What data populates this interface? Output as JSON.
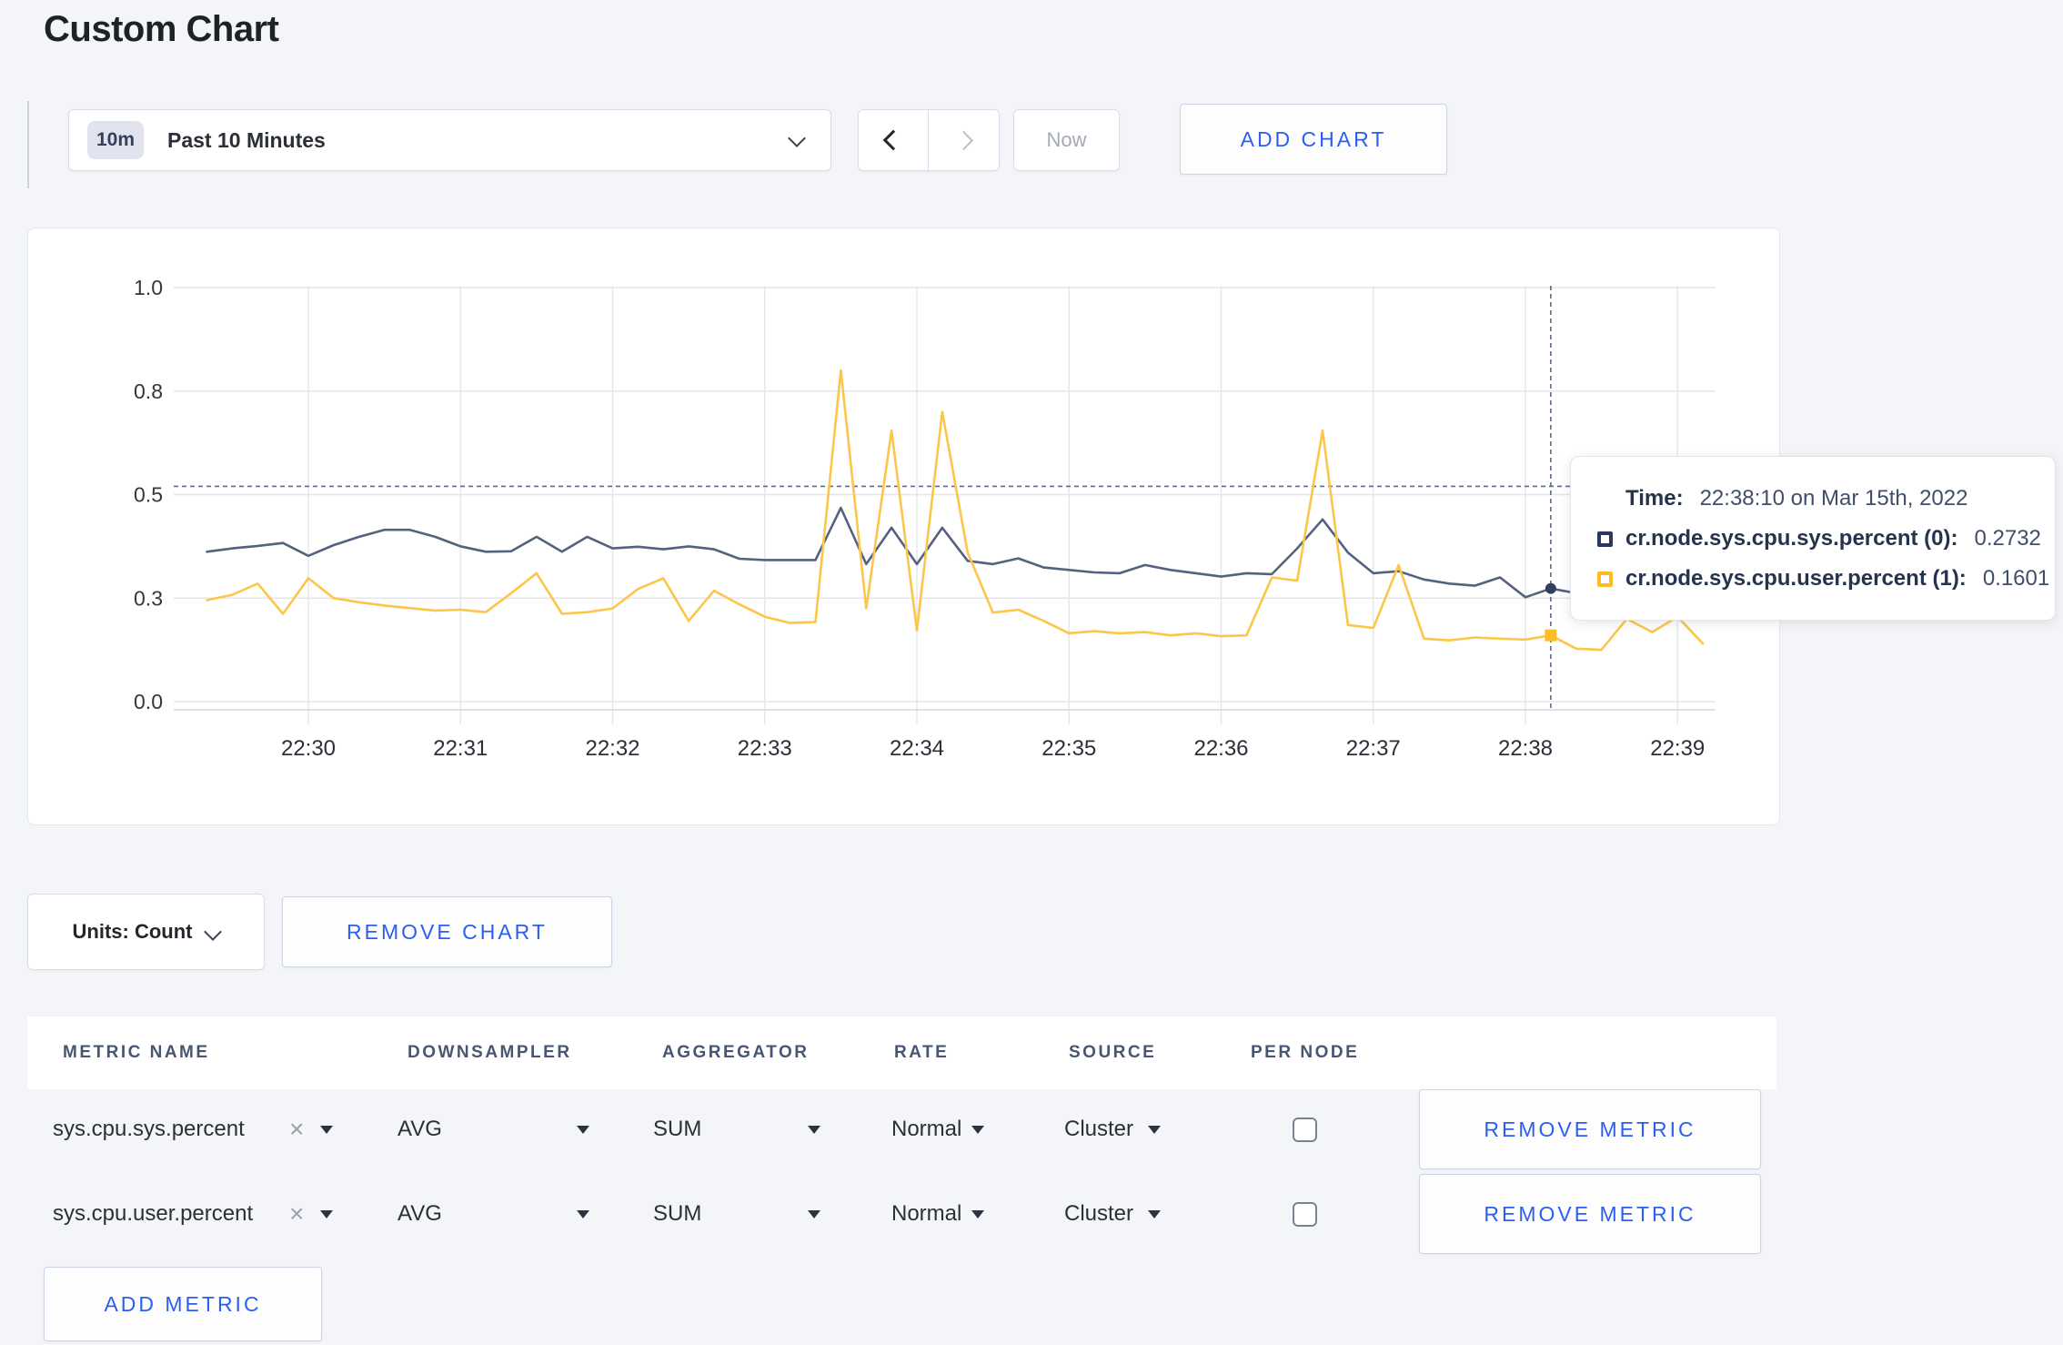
{
  "page": {
    "title": "Custom Chart",
    "background": "#f4f5f8",
    "accent_blue": "#2c5ef0"
  },
  "toolbar": {
    "time_window_badge": "10m",
    "time_window_label": "Past 10 Minutes",
    "now_label": "Now",
    "add_chart_label": "ADD CHART",
    "icons": {
      "time_dropdown": "chevron-down-icon",
      "previous": "chevron-left-icon",
      "next": "chevron-right-icon"
    }
  },
  "chart_data": {
    "type": "line",
    "title": "",
    "xlabel": "",
    "ylabel": "",
    "ylim": [
      0,
      1
    ],
    "grid": true,
    "legend_position": "none",
    "yticks": [
      {
        "v": 0,
        "label": "0.0"
      },
      {
        "v": 0.25,
        "label": "0.3"
      },
      {
        "v": 0.5,
        "label": "0.5"
      },
      {
        "v": 0.75,
        "label": "0.8"
      },
      {
        "v": 1.0,
        "label": "1.0"
      }
    ],
    "xticks": [
      {
        "s": 0,
        "label": "22:30"
      },
      {
        "s": 60,
        "label": "22:31"
      },
      {
        "s": 120,
        "label": "22:32"
      },
      {
        "s": 180,
        "label": "22:33"
      },
      {
        "s": 240,
        "label": "22:34"
      },
      {
        "s": 300,
        "label": "22:35"
      },
      {
        "s": 360,
        "label": "22:36"
      },
      {
        "s": 420,
        "label": "22:37"
      },
      {
        "s": 480,
        "label": "22:38"
      },
      {
        "s": 540,
        "label": "22:39"
      }
    ],
    "x_start_seconds": -40,
    "x_step_seconds": 10,
    "series": [
      {
        "name": "cr.node.sys.cpu.sys.percent (0)",
        "color": "#55627f",
        "values": [
          0.362,
          0.37,
          0.376,
          0.383,
          0.352,
          0.378,
          0.398,
          0.415,
          0.415,
          0.398,
          0.375,
          0.362,
          0.363,
          0.398,
          0.362,
          0.398,
          0.37,
          0.374,
          0.368,
          0.375,
          0.368,
          0.345,
          0.342,
          0.342,
          0.342,
          0.468,
          0.332,
          0.42,
          0.332,
          0.42,
          0.34,
          0.332,
          0.346,
          0.324,
          0.318,
          0.312,
          0.31,
          0.33,
          0.318,
          0.31,
          0.302,
          0.31,
          0.308,
          0.37,
          0.44,
          0.36,
          0.31,
          0.315,
          0.295,
          0.285,
          0.28,
          0.3,
          0.252,
          0.2732,
          0.262,
          0.292,
          0.3,
          0.295,
          0.3,
          0.292
        ]
      },
      {
        "name": "cr.node.sys.cpu.user.percent (1)",
        "color": "#fcc64a",
        "values": [
          0.245,
          0.258,
          0.285,
          0.212,
          0.298,
          0.25,
          0.24,
          0.232,
          0.226,
          0.22,
          0.222,
          0.216,
          0.262,
          0.31,
          0.212,
          0.216,
          0.225,
          0.272,
          0.298,
          0.195,
          0.268,
          0.235,
          0.205,
          0.19,
          0.192,
          0.8,
          0.225,
          0.655,
          0.172,
          0.7,
          0.36,
          0.215,
          0.222,
          0.195,
          0.165,
          0.17,
          0.165,
          0.168,
          0.16,
          0.165,
          0.158,
          0.16,
          0.3,
          0.292,
          0.655,
          0.185,
          0.178,
          0.33,
          0.152,
          0.148,
          0.155,
          0.152,
          0.15,
          0.1601,
          0.128,
          0.125,
          0.2,
          0.168,
          0.205,
          0.14
        ]
      }
    ],
    "crosshair": {
      "x_seconds": 490,
      "mouse_y_value": 0.52,
      "points": [
        {
          "v": 0.2732,
          "color": "#32405f",
          "shape": "circle"
        },
        {
          "v": 0.1601,
          "color": "#fcbe27",
          "shape": "square"
        }
      ]
    }
  },
  "tooltip": {
    "time_label": "Time:",
    "time_value": "22:38:10 on Mar 15th, 2022",
    "rows": [
      {
        "name": "cr.node.sys.cpu.sys.percent (0):",
        "value": "0.2732",
        "swatch_color": "#2b3a5c"
      },
      {
        "name": "cr.node.sys.cpu.user.percent (1):",
        "value": "0.1601",
        "swatch_color": "#fdbd21"
      }
    ]
  },
  "units": {
    "label": "Units: Count"
  },
  "remove_chart_label": "REMOVE CHART",
  "metrics_table": {
    "headers": [
      "METRIC NAME",
      "DOWNSAMPLER",
      "AGGREGATOR",
      "RATE",
      "SOURCE",
      "PER NODE"
    ],
    "rows": [
      {
        "name": "sys.cpu.sys.percent",
        "downsampler": "AVG",
        "aggregator": "SUM",
        "rate": "Normal",
        "source": "Cluster",
        "per_node_checked": false,
        "remove_label": "REMOVE METRIC"
      },
      {
        "name": "sys.cpu.user.percent",
        "downsampler": "AVG",
        "aggregator": "SUM",
        "rate": "Normal",
        "source": "Cluster",
        "per_node_checked": false,
        "remove_label": "REMOVE METRIC"
      }
    ],
    "add_metric_label": "ADD METRIC"
  }
}
